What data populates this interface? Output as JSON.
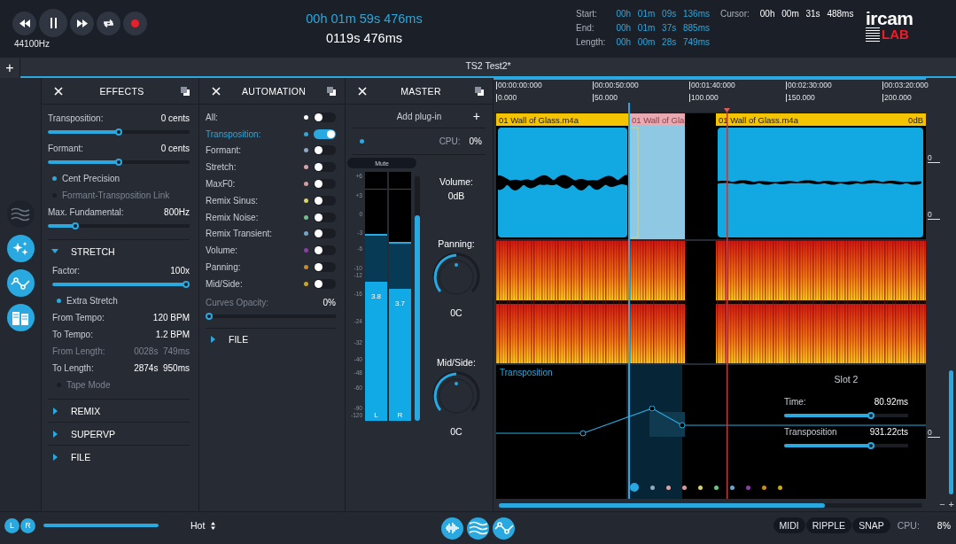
{
  "transport": {
    "sample_rate": "44100Hz",
    "buttons": [
      {
        "kind": "rewind"
      },
      {
        "kind": "pause"
      },
      {
        "kind": "forward"
      },
      {
        "kind": "loop"
      },
      {
        "kind": "record"
      }
    ]
  },
  "clock": {
    "timecode": "00h 01m 59s 476ms",
    "seconds": "0119s 476ms"
  },
  "selection": {
    "rows": [
      {
        "label": "Start:",
        "value": "00h 01m 09s 136ms"
      },
      {
        "label": "End:",
        "value": "00h 01m 37s 885ms"
      },
      {
        "label": "Length:",
        "value": "00h 00m 28s 749ms"
      }
    ],
    "cursor": {
      "label": "Cursor:",
      "value": "00h 00m 31s 488ms"
    }
  },
  "logo": {
    "top": "ircam",
    "bottom": "LAB"
  },
  "tab_bar": {
    "add": "+",
    "title": "TS2 Test2*"
  },
  "sidebar_tools": [
    {
      "kind": "waves",
      "active": false
    },
    {
      "kind": "sparkle",
      "active": true
    },
    {
      "kind": "curve",
      "active": true
    },
    {
      "kind": "columns",
      "active": true
    }
  ],
  "effects": {
    "title": "EFFECTS",
    "controls": [
      {
        "kind": "slider",
        "label": "Transposition:",
        "value": "0 cents",
        "level": 0.5
      },
      {
        "kind": "slider",
        "label": "Formant:",
        "value": "0 cents",
        "level": 0.5
      },
      {
        "kind": "option",
        "label": "Cent Precision",
        "on": true
      },
      {
        "kind": "option",
        "label": "Formant-Transposition Link",
        "on": false
      },
      {
        "kind": "slider",
        "label": "Max. Fundamental:",
        "value": "800Hz",
        "level": 0.18
      }
    ],
    "sections": [
      {
        "title": "STRETCH",
        "expanded": true,
        "controls": [
          {
            "kind": "slider",
            "label": "Factor:",
            "value": "100x",
            "level": 1
          },
          {
            "kind": "option",
            "label": "Extra Stretch",
            "on": true
          },
          {
            "kind": "field",
            "label": "From Tempo:",
            "value": "120 BPM",
            "disabled": false
          },
          {
            "kind": "field",
            "label": "To Tempo:",
            "value": "1.2 BPM",
            "disabled": false
          },
          {
            "kind": "field",
            "label": "From Length:",
            "value": "0028s  749ms",
            "disabled": true
          },
          {
            "kind": "field",
            "label": "To Length:",
            "value": "2874s  950ms",
            "disabled": false
          },
          {
            "kind": "option",
            "label": "Tape Mode",
            "on": false
          }
        ]
      },
      {
        "title": "REMIX",
        "expanded": false
      },
      {
        "title": "SUPERVP",
        "expanded": false
      },
      {
        "title": "FILE",
        "expanded": false
      }
    ]
  },
  "automation": {
    "title": "AUTOMATION",
    "rows": [
      {
        "label": "All:",
        "color": "#ffffff",
        "on": false,
        "selected": false
      },
      {
        "label": "Transposition:",
        "color": "#29a9e0",
        "on": true,
        "selected": true
      },
      {
        "label": "Formant:",
        "color": "#8fa9c4",
        "on": false,
        "selected": false
      },
      {
        "label": "Stretch:",
        "color": "#d9a3a8",
        "on": false,
        "selected": false
      },
      {
        "label": "MaxF0:",
        "color": "#d99a9a",
        "on": false,
        "selected": false
      },
      {
        "label": "Remix Sinus:",
        "color": "#d9d36a",
        "on": false,
        "selected": false
      },
      {
        "label": "Remix Noise:",
        "color": "#6cc48a",
        "on": false,
        "selected": false
      },
      {
        "label": "Remix Transient:",
        "color": "#6aa8d0",
        "on": false,
        "selected": false
      },
      {
        "label": "Volume:",
        "color": "#8a3fa8",
        "on": false,
        "selected": false
      },
      {
        "label": "Panning:",
        "color": "#c98a2a",
        "on": false,
        "selected": false
      },
      {
        "label": "Mid/Side:",
        "color": "#c9a91c",
        "on": false,
        "selected": false
      }
    ],
    "opacity": {
      "label": "Curves Opacity:",
      "value": "0%",
      "level": 0
    },
    "sections": [
      {
        "title": "FILE",
        "expanded": false
      }
    ]
  },
  "master": {
    "title": "MASTER",
    "add_plugin": {
      "label": "Add plug-in",
      "icon": "+"
    },
    "cpu": {
      "label": "CPU:",
      "value": "0%"
    },
    "mute": "Mute",
    "scale": [
      "+6",
      "+3",
      "0",
      "-3",
      "-6",
      "-10",
      "-12",
      "-16",
      "-24",
      "-32",
      "-40",
      "-48",
      "-60",
      "-90",
      "-120"
    ],
    "channels": [
      {
        "label": "L",
        "reading": "3.8",
        "level": 0.56
      },
      {
        "label": "R",
        "reading": "3.7",
        "level": 0.53
      }
    ],
    "volume": {
      "label": "Volume:",
      "value": "0dB",
      "level": 0.84
    },
    "knobs": [
      {
        "label": "Panning:",
        "value": "0C"
      },
      {
        "label": "Mid/Side:",
        "value": "0C"
      }
    ]
  },
  "timeline": {
    "ruler": {
      "timecodes": [
        "00:00:00:000",
        "00:00:50:000",
        "00:01:40:000",
        "00:02:30:000",
        "00:03:20:000"
      ],
      "seconds": [
        "0.000",
        "50.000",
        "100.000",
        "150.000",
        "200.000"
      ]
    },
    "clips": [
      {
        "name": "01 Wall of Glass.m4a",
        "ghost": false
      },
      {
        "name": "01 Wall of Gla",
        "ghost": true
      },
      {
        "name": "01 Wall of Glass.m4a",
        "ghost": false,
        "gain": "0dB"
      }
    ],
    "wave_scale": [
      "0",
      "0"
    ],
    "lane": {
      "title": "Transposition",
      "scale": "0",
      "slot": {
        "title": "Slot 2",
        "params": [
          {
            "label": "Time:",
            "value": "80.92ms",
            "level": 0.71
          },
          {
            "label": "Transposition",
            "value": "931.22cts",
            "level": 0.71
          }
        ]
      },
      "dots": [
        {
          "color": "#29a9e0",
          "selected": true
        },
        {
          "color": "#8fa9c4",
          "selected": false
        },
        {
          "color": "#d9a3a8",
          "selected": false
        },
        {
          "color": "#d99a9a",
          "selected": false
        },
        {
          "color": "#d9d36a",
          "selected": false
        },
        {
          "color": "#6cc48a",
          "selected": false
        },
        {
          "color": "#6aa8d0",
          "selected": false
        },
        {
          "color": "#8a3fa8",
          "selected": false
        },
        {
          "color": "#c98a2a",
          "selected": false
        },
        {
          "color": "#c9a91c",
          "selected": false
        }
      ]
    },
    "zoom": {
      "out": "−",
      "in": "+"
    }
  },
  "bottom": {
    "channels": [
      "L",
      "R"
    ],
    "balance": {
      "level": 1
    },
    "mode": "Hot",
    "tools": [
      {
        "kind": "wave"
      },
      {
        "kind": "waves"
      },
      {
        "kind": "curve"
      }
    ],
    "flags": [
      "MIDI",
      "RIPPLE",
      "SNAP"
    ],
    "cpu": {
      "label": "CPU:",
      "value": "8%"
    }
  }
}
